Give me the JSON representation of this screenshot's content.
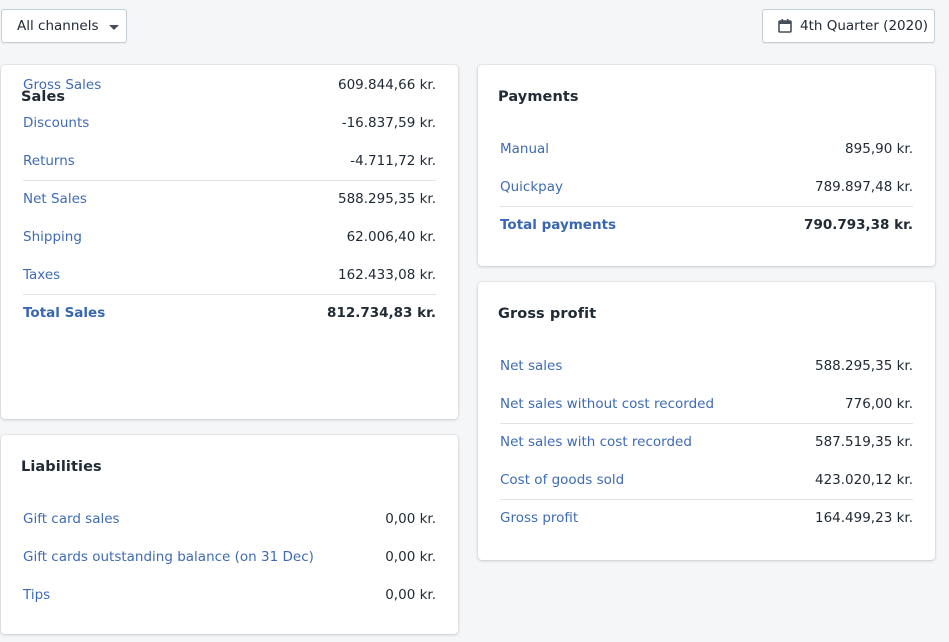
{
  "toolbar": {
    "channel_select": "All channels",
    "date_range": "4th Quarter (2020)"
  },
  "sales": {
    "title": "Sales",
    "rows": [
      {
        "label": "Gross Sales",
        "value": "609.844,66 kr."
      },
      {
        "label": "Discounts",
        "value": "-16.837,59 kr."
      },
      {
        "label": "Returns",
        "value": "-4.711,72 kr."
      },
      {
        "label": "Net Sales",
        "value": "588.295,35 kr."
      },
      {
        "label": "Shipping",
        "value": "62.006,40 kr."
      },
      {
        "label": "Taxes",
        "value": "162.433,08 kr."
      },
      {
        "label": "Total Sales",
        "value": "812.734,83 kr."
      }
    ]
  },
  "liabilities": {
    "title": "Liabilities",
    "rows": [
      {
        "label": "Gift card sales",
        "value": "0,00 kr."
      },
      {
        "label": "Gift cards outstanding balance (on 31 Dec)",
        "value": "0,00 kr."
      },
      {
        "label": "Tips",
        "value": "0,00 kr."
      }
    ]
  },
  "payments": {
    "title": "Payments",
    "rows": [
      {
        "label": "Manual",
        "value": "895,90 kr."
      },
      {
        "label": "Quickpay",
        "value": "789.897,48 kr."
      },
      {
        "label": "Total payments",
        "value": "790.793,38 kr."
      }
    ]
  },
  "gross_profit": {
    "title": "Gross profit",
    "rows": [
      {
        "label": "Net sales",
        "value": "588.295,35 kr."
      },
      {
        "label": "Net sales without cost recorded",
        "value": "776,00 kr."
      },
      {
        "label": "Net sales with cost recorded",
        "value": "587.519,35 kr."
      },
      {
        "label": "Cost of goods sold",
        "value": "423.020,12 kr."
      },
      {
        "label": "Gross profit",
        "value": "164.499,23 kr."
      }
    ]
  },
  "colors": {
    "link": "#3f6bb4",
    "text": "#212b36",
    "background": "#f4f6f8"
  }
}
